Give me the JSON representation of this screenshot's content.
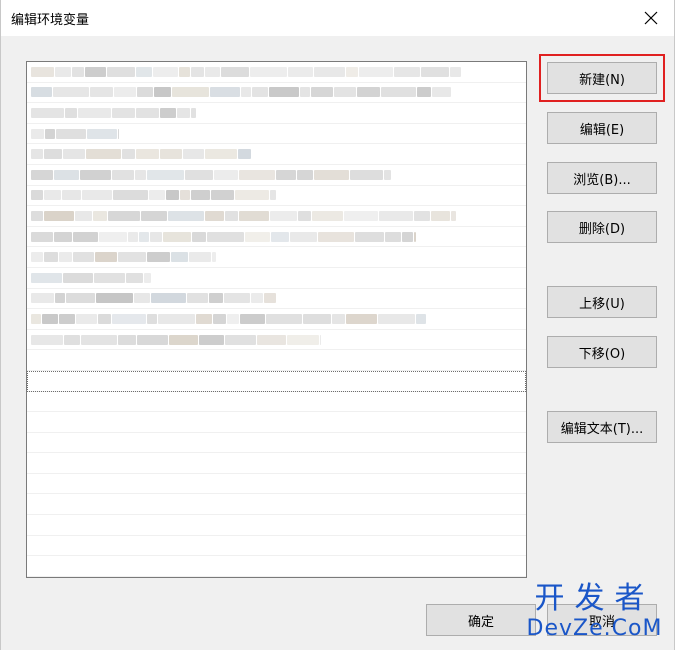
{
  "window": {
    "title": "编辑环境变量",
    "close_glyph": "✕"
  },
  "buttons": {
    "new": "新建(N)",
    "edit": "编辑(E)",
    "browse": "浏览(B)...",
    "delete": "删除(D)",
    "move_up": "上移(U)",
    "move_down": "下移(O)",
    "edit_text": "编辑文本(T)...",
    "ok": "确定",
    "cancel": "取消"
  },
  "watermark": {
    "line1": "开发者",
    "line2": "DevZe.CoM"
  },
  "list": {
    "row_count": 25,
    "blurred_rows": 16
  }
}
